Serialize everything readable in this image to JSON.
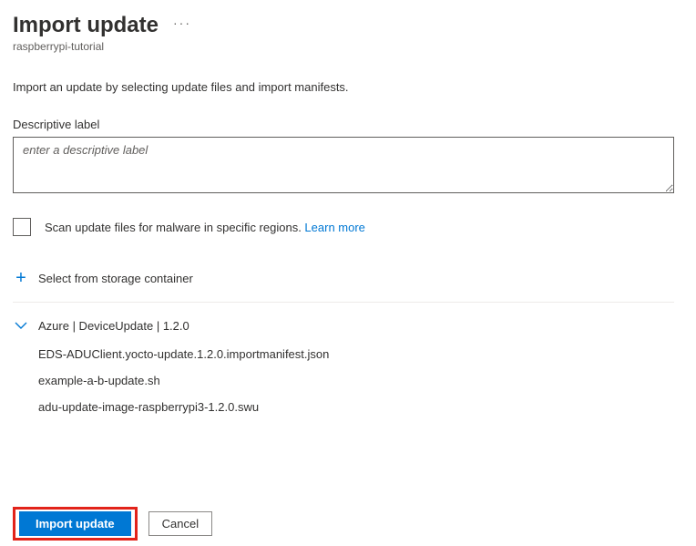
{
  "header": {
    "title": "Import update",
    "subtitle": "raspberrypi-tutorial"
  },
  "description": "Import an update by selecting update files and import manifests.",
  "descLabel": {
    "label": "Descriptive label",
    "placeholder": "enter a descriptive label"
  },
  "malware": {
    "label": "Scan update files for malware in specific regions. ",
    "link": "Learn more"
  },
  "storage": {
    "selectLabel": "Select from storage container",
    "expandLabel": "Azure | DeviceUpdate | 1.2.0",
    "files": [
      "EDS-ADUClient.yocto-update.1.2.0.importmanifest.json",
      "example-a-b-update.sh",
      "adu-update-image-raspberrypi3-1.2.0.swu"
    ]
  },
  "footer": {
    "primary": "Import update",
    "secondary": "Cancel"
  }
}
